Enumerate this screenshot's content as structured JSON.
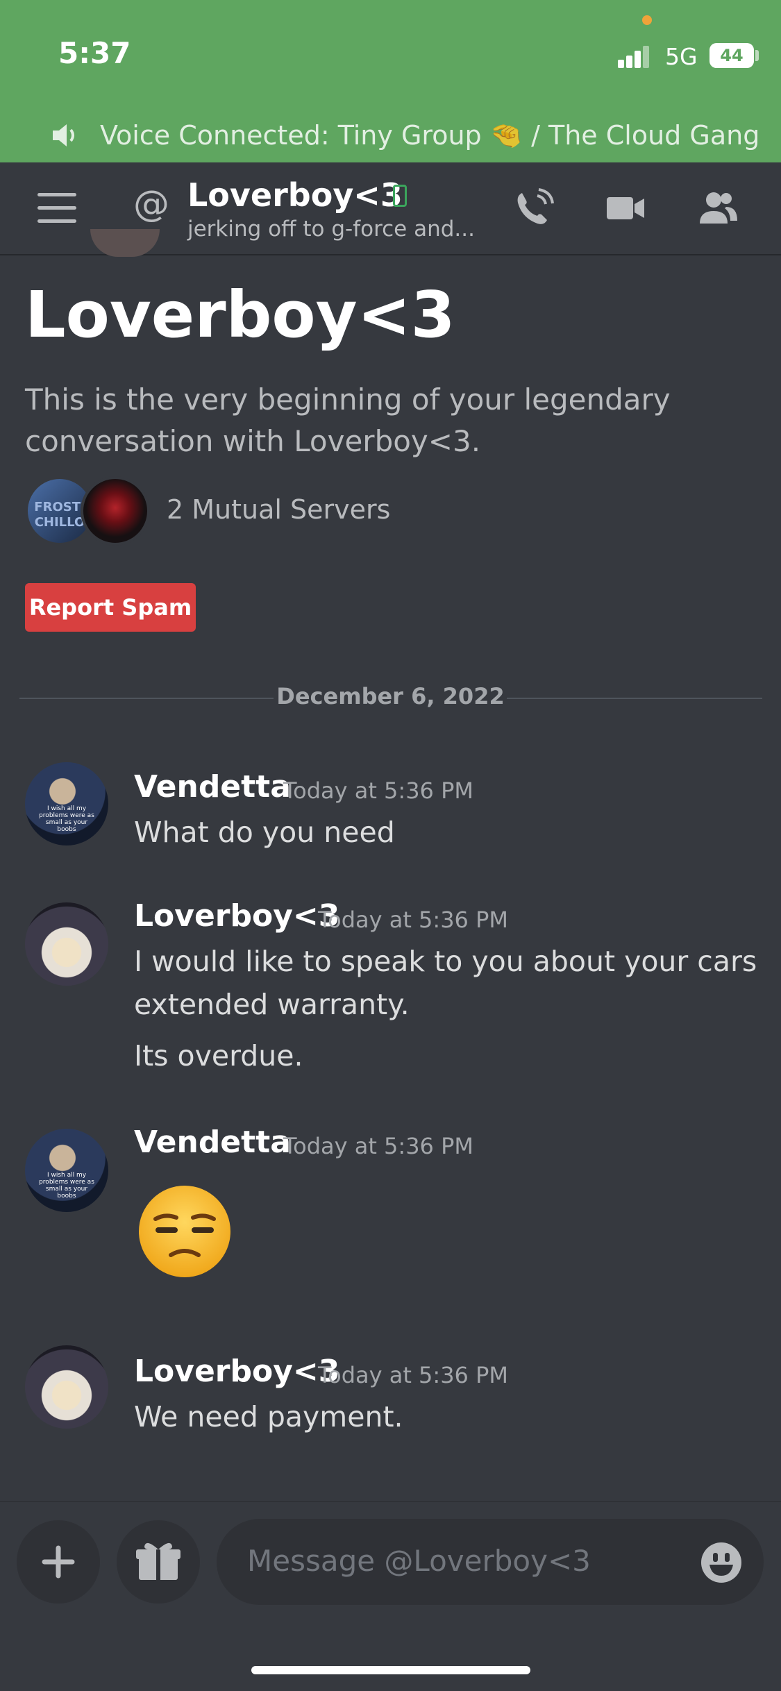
{
  "status_bar": {
    "time": "5:37",
    "network": "5G",
    "battery": "44"
  },
  "voice_banner": {
    "text": "Voice Connected: Tiny Group 🤏 / The Cloud Gang"
  },
  "header": {
    "at_symbol": "@",
    "name": "Loverboy<3",
    "status": "jerking off to g-force and..."
  },
  "profile": {
    "name": "Loverboy<3",
    "intro": "This is the very beginning of your legendary conversation with Loverboy<3.",
    "server_icon_text": "FROSTI CHILLO",
    "mutual_servers": "2 Mutual Servers",
    "report_label": "Report Spam"
  },
  "date_divider": "December 6, 2022",
  "messages": [
    {
      "author": "Vendetta",
      "timestamp": "Today at 5:36 PM",
      "lines": [
        "What do you need"
      ]
    },
    {
      "author": "Loverboy<3",
      "timestamp": "Today at 5:36 PM",
      "lines": [
        "I would like to speak to you about your cars extended warranty.",
        "Its overdue."
      ]
    },
    {
      "author": "Vendetta",
      "timestamp": "Today at 5:36 PM",
      "lines": [],
      "emoji": "unamused-face"
    },
    {
      "author": "Loverboy<3",
      "timestamp": "Today at 5:36 PM",
      "lines": [
        "We need payment."
      ]
    }
  ],
  "avatar_caption": "I wish all my problems were as small as your boobs",
  "input": {
    "placeholder": "Message @Loverboy<3"
  },
  "icons": {
    "speaker": "speaker-icon",
    "menu": "hamburger-icon",
    "call": "call-icon",
    "video": "video-icon",
    "members": "members-icon",
    "add": "plus-icon",
    "gift": "gift-icon",
    "emoji": "emoji-icon"
  },
  "colors": {
    "voice_banner": "#5fa660",
    "background": "#36393f",
    "report_button": "#d84040",
    "online_mobile": "#3ba55c"
  }
}
